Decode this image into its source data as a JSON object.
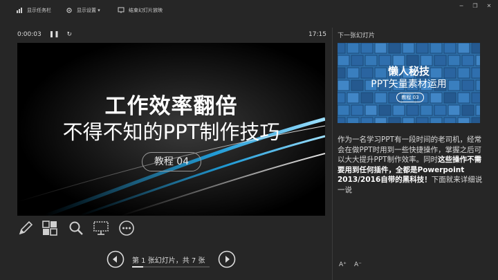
{
  "toolbar": {
    "show_taskbar": "显示任务栏",
    "display_settings": "显示设置 ▾",
    "end_slideshow": "结束幻灯片放映",
    "icons": [
      "taskbar-icon",
      "display-settings-icon",
      "end-slideshow-icon",
      "minimize-icon",
      "restore-icon",
      "close-icon"
    ]
  },
  "timer": {
    "elapsed": "0:00:03",
    "clock": "17:15"
  },
  "current_slide": {
    "title_line1": "工作效率翻倍",
    "title_line2": "不得不知的PPT制作技巧",
    "tag": "教程 04"
  },
  "tools": [
    "pen-icon",
    "slide-grid-icon",
    "zoom-icon",
    "screen-icon",
    "more-icon"
  ],
  "navigation": {
    "counter": "第 1 张幻灯片，共 7 张",
    "current": 1,
    "total": 7
  },
  "next_slide": {
    "label": "下一张幻灯片",
    "title_line1": "懒人秘技",
    "title_line2": "PPT矢量素材运用",
    "tag": "教程 03"
  },
  "notes": {
    "part1": "作为一名学习PPT有一段时间的老司机，经常会在做PPT时用到一些快捷操作，掌握之后可以大大提升PPT制作效率。同时",
    "bold": "这些操作不需要用到任何插件，全都是Powerpoint 2013/2016自带的黑科技！",
    "part2": "下面就来详细说一说"
  },
  "font_controls": {
    "increase": "A⁺",
    "decrease": "A⁻"
  },
  "colors": {
    "background": "#262626",
    "next_slide_blue": "#2e6fa8",
    "accent_streak": "#1fa7e8"
  }
}
